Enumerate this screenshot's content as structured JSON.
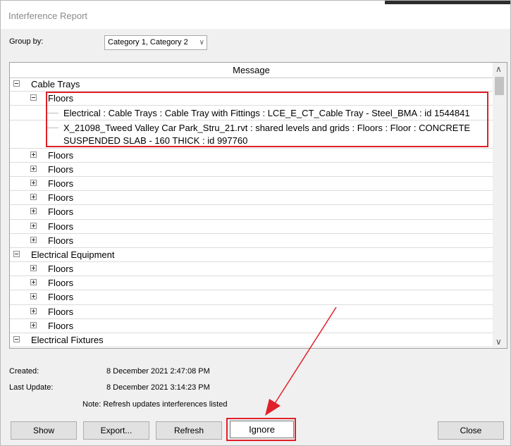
{
  "window": {
    "title": "Interference Report"
  },
  "groupby": {
    "label": "Group by:",
    "value": "Category 1, Category 2"
  },
  "grid": {
    "header": "Message",
    "rows": [
      {
        "level": 0,
        "expander": "minus",
        "text": "Cable Trays"
      },
      {
        "level": 1,
        "expander": "minus",
        "text": "Floors"
      },
      {
        "level": 2,
        "text": "Electrical : Cable Trays : Cable Tray with Fittings : LCE_E_CT_Cable Tray - Steel_BMA : id 1544841"
      },
      {
        "level": 2,
        "text": "X_21098_Tweed Valley Car Park_Stru_21.rvt : shared levels and grids : Floors : Floor : CONCRETE SUSPENDED SLAB - 160 THICK : id 997760"
      },
      {
        "level": 1,
        "expander": "plus",
        "text": "Floors"
      },
      {
        "level": 1,
        "expander": "plus",
        "text": "Floors"
      },
      {
        "level": 1,
        "expander": "plus",
        "text": "Floors"
      },
      {
        "level": 1,
        "expander": "plus",
        "text": "Floors"
      },
      {
        "level": 1,
        "expander": "plus",
        "text": "Floors"
      },
      {
        "level": 1,
        "expander": "plus",
        "text": "Floors"
      },
      {
        "level": 1,
        "expander": "plus",
        "text": "Floors"
      },
      {
        "level": 0,
        "expander": "minus",
        "text": "Electrical Equipment"
      },
      {
        "level": 1,
        "expander": "plus",
        "text": "Floors"
      },
      {
        "level": 1,
        "expander": "plus",
        "text": "Floors"
      },
      {
        "level": 1,
        "expander": "plus",
        "text": "Floors"
      },
      {
        "level": 1,
        "expander": "plus",
        "text": "Floors"
      },
      {
        "level": 1,
        "expander": "plus",
        "text": "Floors"
      },
      {
        "level": 0,
        "expander": "minus",
        "text": "Electrical Fixtures"
      }
    ]
  },
  "info": {
    "created_label": "Created:",
    "created_value": "8 December 2021 2:47:08 PM",
    "updated_label": "Last Update:",
    "updated_value": "8 December 2021 3:14:23 PM",
    "note": "Note: Refresh updates interferences listed"
  },
  "buttons": {
    "show": "Show",
    "export": "Export...",
    "refresh": "Refresh",
    "ignore": "Ignore",
    "close": "Close"
  },
  "colors": {
    "annotation": "#e0202a"
  }
}
